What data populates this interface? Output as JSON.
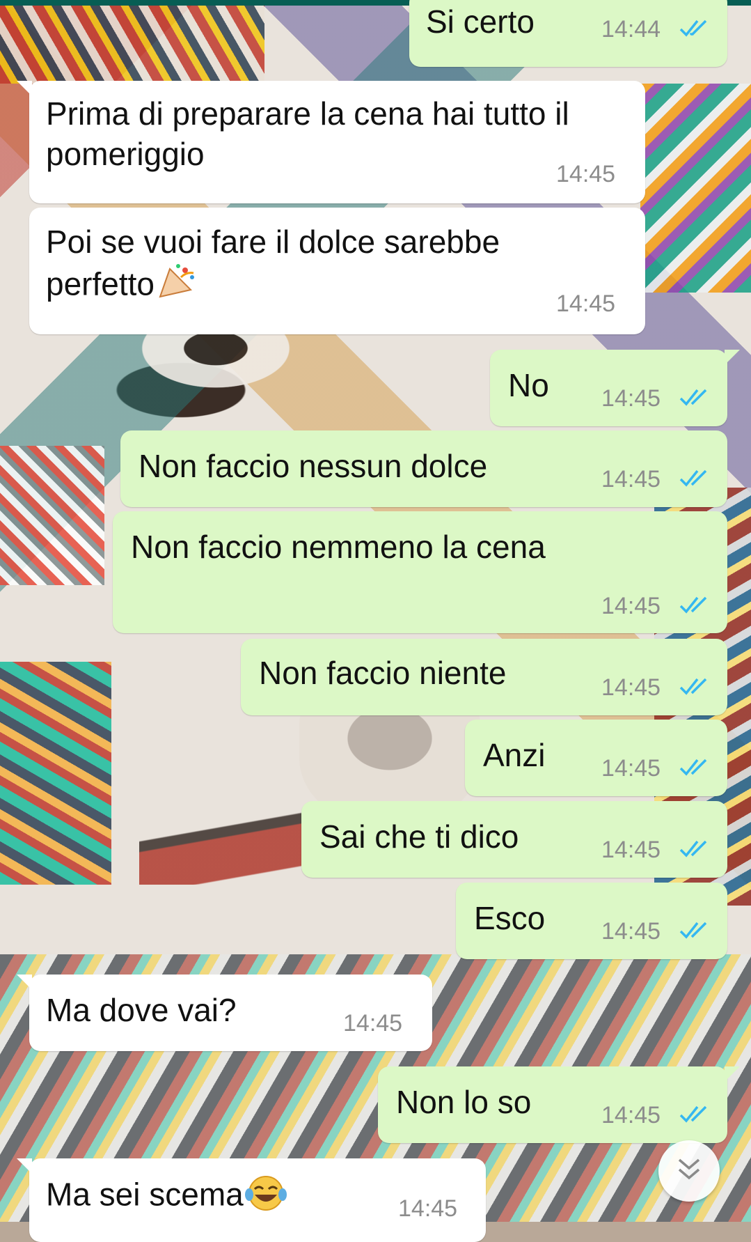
{
  "chat": {
    "messages": [
      {
        "direction": "out",
        "text": "Si certo",
        "time": "14:44",
        "status": "read"
      },
      {
        "direction": "in",
        "text": "Prima di preparare la cena hai tutto il pomeriggio",
        "time": "14:45"
      },
      {
        "direction": "in",
        "text": "Poi se vuoi fare il dolce sarebbe perfetto",
        "emoji": "party-popper-emoji",
        "time": "14:45"
      },
      {
        "direction": "out",
        "text": "No",
        "time": "14:45",
        "status": "read"
      },
      {
        "direction": "out",
        "text": "Non faccio nessun dolce",
        "time": "14:45",
        "status": "read"
      },
      {
        "direction": "out",
        "text": "Non faccio nemmeno la cena",
        "time": "14:45",
        "status": "read"
      },
      {
        "direction": "out",
        "text": "Non faccio niente",
        "time": "14:45",
        "status": "read"
      },
      {
        "direction": "out",
        "text": "Anzi",
        "time": "14:45",
        "status": "read"
      },
      {
        "direction": "out",
        "text": "Sai che ti dico",
        "time": "14:45",
        "status": "read"
      },
      {
        "direction": "out",
        "text": "Esco",
        "time": "14:45",
        "status": "read"
      },
      {
        "direction": "in",
        "text": "Ma dove vai?",
        "time": "14:45"
      },
      {
        "direction": "out",
        "text": "Non lo so",
        "time": "14:45",
        "status": "read"
      },
      {
        "direction": "in",
        "text": "Ma sei scema",
        "emoji": "tears-of-joy-emoji",
        "time": "14:45"
      }
    ]
  },
  "colors": {
    "incoming_bubble": "#ffffff",
    "outgoing_bubble": "#dcf8c6",
    "read_ticks": "#34b7f1",
    "timestamp": "#8c8c8c"
  },
  "controls": {
    "scroll_to_bottom_icon": "double-chevron-down-icon"
  }
}
